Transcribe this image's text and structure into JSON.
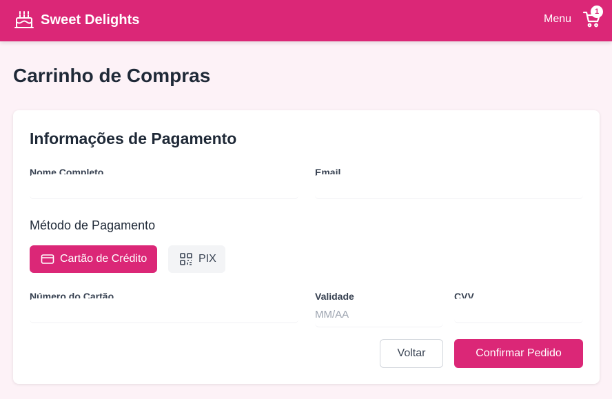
{
  "header": {
    "brand_name": "Sweet Delights",
    "brand_icon": "cake-icon",
    "menu_label": "Menu",
    "cart_icon": "cart-icon",
    "cart_count": "1"
  },
  "page": {
    "title": "Carrinho de Compras"
  },
  "payment_form": {
    "title": "Informações de Pagamento",
    "name_label": "Nome Completo",
    "name_value": "",
    "email_label": "Email",
    "email_value": "",
    "method_title": "Método de Pagamento",
    "methods": [
      {
        "label": "Cartão de Crédito",
        "icon": "credit-card-icon",
        "selected": true
      },
      {
        "label": "PIX",
        "icon": "qr-code-icon",
        "selected": false
      }
    ],
    "card_number_label": "Número do Cartão",
    "card_number_value": "",
    "expiry_label": "Validade",
    "expiry_placeholder": "MM/AA",
    "cvv_label": "CVV",
    "cvv_value": "",
    "back_label": "Voltar",
    "confirm_label": "Confirmar Pedido"
  },
  "colors": {
    "primary": "#db2777",
    "background": "#fdf2f7",
    "card": "#ffffff",
    "text": "#1f2937"
  }
}
